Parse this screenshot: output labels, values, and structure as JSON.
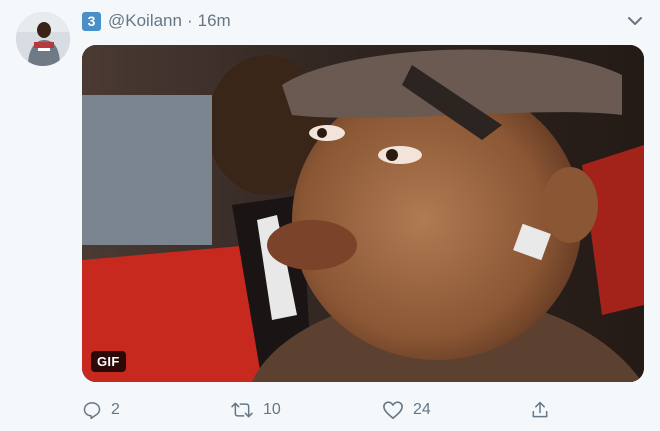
{
  "tweet": {
    "badge": "3",
    "handle": "@Koilann",
    "separator": "·",
    "time": "16m",
    "media_badge": "GIF",
    "reply_count": "2",
    "retweet_count": "10",
    "like_count": "24"
  },
  "icons": {
    "caret": "chevron-down-icon",
    "reply": "reply-icon",
    "retweet": "retweet-icon",
    "like": "heart-icon",
    "share": "share-icon"
  },
  "colors": {
    "background": "#f5f8fa",
    "secondary_text": "#657786",
    "badge": "#4a90c8"
  }
}
